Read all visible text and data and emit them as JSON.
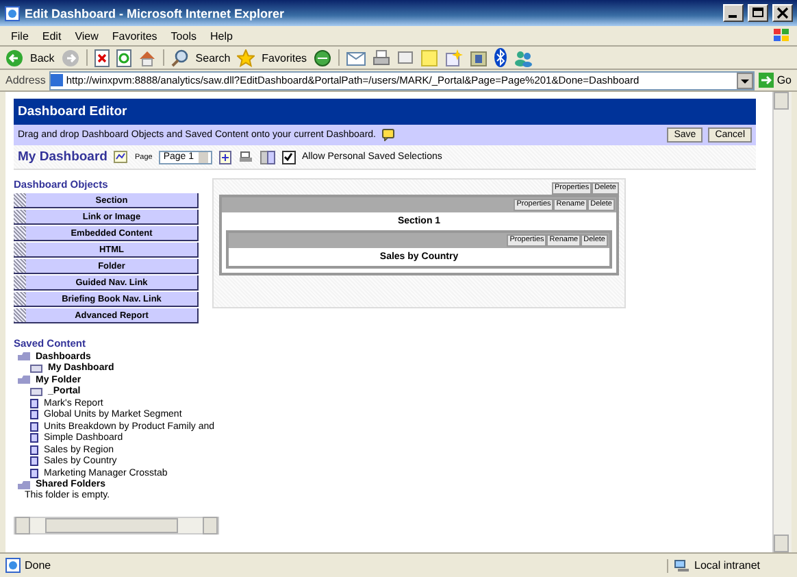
{
  "window": {
    "title": "Edit Dashboard - Microsoft Internet Explorer"
  },
  "menu": [
    {
      "label": "File"
    },
    {
      "label": "Edit"
    },
    {
      "label": "View"
    },
    {
      "label": "Favorites"
    },
    {
      "label": "Tools"
    },
    {
      "label": "Help"
    }
  ],
  "toolbar": {
    "back": "Back",
    "search": "Search",
    "favorites": "Favorites"
  },
  "address": {
    "label": "Address",
    "value": "http://winxpvm:8888/analytics/saw.dll?EditDashboard&PortalPath=/users/MARK/_Portal&Page=Page%201&Done=Dashboard",
    "go": "Go"
  },
  "editor": {
    "title": "Dashboard Editor",
    "instruction": "Drag and drop Dashboard Objects and Saved Content onto your current Dashboard.",
    "save": "Save",
    "cancel": "Cancel",
    "dashboard_name": "My Dashboard",
    "page_label": "Page",
    "page_select": "Page 1",
    "allow_personal": {
      "label": "Allow Personal Saved Selections",
      "checked": true
    }
  },
  "objects": {
    "heading": "Dashboard Objects",
    "items": [
      "Section",
      "Link or Image",
      "Embedded Content",
      "HTML",
      "Folder",
      "Guided Nav. Link",
      "Briefing Book Nav. Link",
      "Advanced Report"
    ]
  },
  "canvas": {
    "buttons": [
      "Properties",
      "Delete"
    ],
    "section": {
      "title": "Section 1",
      "buttons": [
        "Properties",
        "Rename",
        "Delete"
      ],
      "report": {
        "title": "Sales by Country",
        "buttons": [
          "Properties",
          "Rename",
          "Delete"
        ]
      }
    }
  },
  "saved_content": {
    "heading": "Saved Content",
    "tree": [
      {
        "label": "Dashboards",
        "kind": "root",
        "children": [
          {
            "label": "My Dashboard",
            "kind": "folder"
          }
        ]
      },
      {
        "label": "My Folder",
        "kind": "root",
        "children": [
          {
            "label": "_Portal",
            "kind": "folder"
          },
          {
            "label": "Mark's Report",
            "kind": "report"
          },
          {
            "label": "Global Units by Market Segment",
            "kind": "report"
          },
          {
            "label": "Units Breakdown by Product Family and",
            "kind": "report"
          },
          {
            "label": "Simple Dashboard",
            "kind": "report"
          },
          {
            "label": "Sales by Region",
            "kind": "report"
          },
          {
            "label": "Sales by Country",
            "kind": "report"
          },
          {
            "label": "Marketing Manager Crosstab",
            "kind": "report"
          }
        ]
      },
      {
        "label": "Shared Folders",
        "kind": "root",
        "note": "This folder is empty."
      }
    ]
  },
  "status": {
    "text": "Done",
    "zone": "Local intranet"
  }
}
